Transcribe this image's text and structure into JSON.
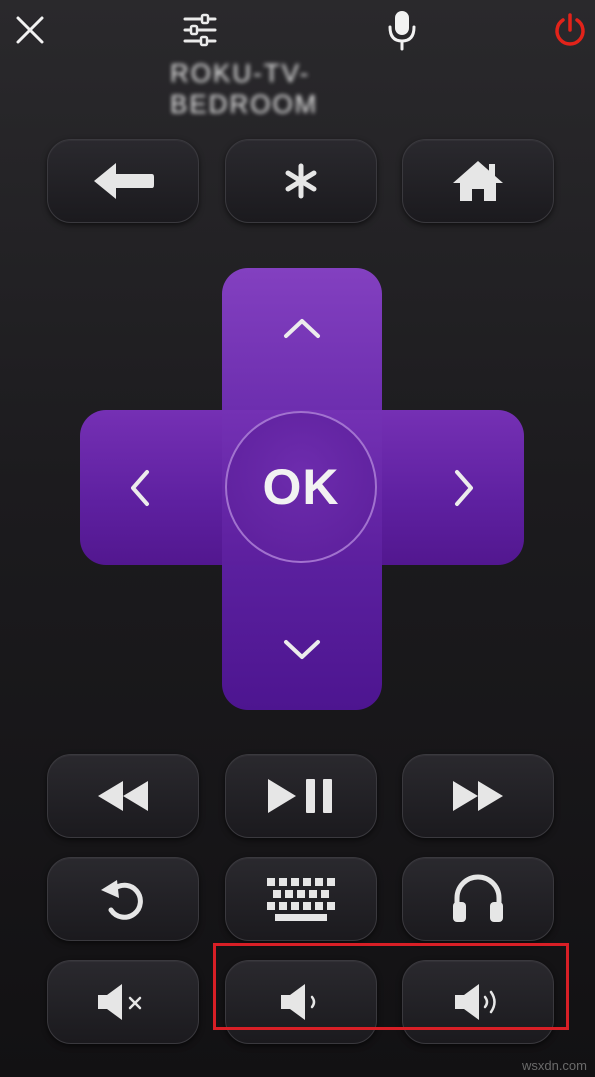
{
  "top_bar": {
    "close": "close-icon",
    "settings": "sliders-icon",
    "voice": "microphone-icon",
    "power": "power-icon",
    "power_color": "#e2231a"
  },
  "device_name": "ROKU-TV-BEDROOM",
  "nav_row": [
    "back-arrow-icon",
    "asterisk-icon",
    "home-icon"
  ],
  "dpad": {
    "ok_label": "OK",
    "color": "#6a2bb0"
  },
  "media_row": [
    "rewind-icon",
    "play-pause-icon",
    "fast-forward-icon"
  ],
  "utility_row": [
    "replay-icon",
    "keyboard-icon",
    "headphones-icon"
  ],
  "volume_row": [
    "volume-mute-icon",
    "volume-down-icon",
    "volume-up-icon"
  ],
  "highlight_color": "#d81f26",
  "watermark": "wsxdn.com"
}
